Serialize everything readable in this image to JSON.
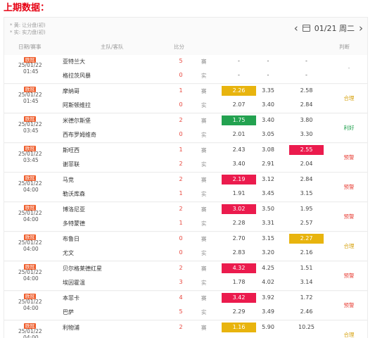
{
  "title": "上期数据：",
  "notes": [
    "* 黄: 让分盘(初)",
    "* 实: 实力盘(初)"
  ],
  "nav": {
    "prev": "‹",
    "next": "›",
    "date": "01/21 周二"
  },
  "columns": {
    "date": "日期/赛事",
    "teams": "主队/客队",
    "score": "比分",
    "judge": "判断"
  },
  "colors": {
    "yellow": "#e8b40e",
    "green": "#23a250",
    "red": "#eb1b4d",
    "win": "#23a250",
    "verdict_red": "#e8453c",
    "verdict_yellow": "#d6a10d"
  },
  "matches": [
    {
      "league": "欧冠",
      "date": "25/01/22",
      "time": "01:45",
      "home": "亚特兰大",
      "away": "格拉茨风暴",
      "hs": "5",
      "as": "0",
      "tag1": "赛",
      "tag2": "实",
      "r1": [
        "-",
        "-",
        "-"
      ],
      "r2": [
        "-",
        "-",
        "-"
      ],
      "hl": [
        null,
        null,
        null
      ],
      "verdict": "-",
      "vcolor": "#999"
    },
    {
      "league": "欧冠",
      "date": "25/01/22",
      "time": "01:45",
      "home": "摩纳哥",
      "away": "阿斯顿维拉",
      "hs": "1",
      "as": "0",
      "tag1": "赛",
      "tag2": "实",
      "r1": [
        "2.26",
        "3.35",
        "2.58"
      ],
      "r2": [
        "2.07",
        "3.40",
        "2.84"
      ],
      "hl": [
        "yellow",
        null,
        null
      ],
      "verdict": "合理",
      "vcolor": "#d6a10d"
    },
    {
      "league": "欧冠",
      "date": "25/01/22",
      "time": "03:45",
      "home": "米德尔斯堡",
      "away": "西布罗姆维奇",
      "hs": "2",
      "as": "0",
      "tag1": "赛",
      "tag2": "实",
      "r1": [
        "1.75",
        "3.40",
        "3.80"
      ],
      "r2": [
        "2.01",
        "3.05",
        "3.30"
      ],
      "hl": [
        "green",
        null,
        null
      ],
      "verdict": "利好",
      "vcolor": "#23a250"
    },
    {
      "league": "欧冠",
      "date": "25/01/22",
      "time": "03:45",
      "home": "斯旺西",
      "away": "谢菲联",
      "hs": "1",
      "as": "2",
      "tag1": "赛",
      "tag2": "实",
      "r1": [
        "2.43",
        "3.08",
        "2.55"
      ],
      "r2": [
        "3.40",
        "2.91",
        "2.04"
      ],
      "hl": [
        null,
        null,
        "red"
      ],
      "verdict": "预警",
      "vcolor": "#e8453c"
    },
    {
      "league": "欧冠",
      "date": "25/01/22",
      "time": "04:00",
      "home": "马竞",
      "away": "勒沃库森",
      "hs": "2",
      "as": "1",
      "tag1": "赛",
      "tag2": "实",
      "r1": [
        "2.19",
        "3.12",
        "2.84"
      ],
      "r2": [
        "1.91",
        "3.45",
        "3.15"
      ],
      "hl": [
        "red",
        null,
        null
      ],
      "verdict": "预警",
      "vcolor": "#e8453c"
    },
    {
      "league": "欧冠",
      "date": "25/01/22",
      "time": "04:00",
      "home": "博洛尼亚",
      "away": "多特蒙德",
      "hs": "2",
      "as": "1",
      "tag1": "赛",
      "tag2": "实",
      "r1": [
        "3.02",
        "3.50",
        "1.95"
      ],
      "r2": [
        "2.28",
        "3.31",
        "2.57"
      ],
      "hl": [
        "red",
        null,
        null
      ],
      "verdict": "预警",
      "vcolor": "#e8453c"
    },
    {
      "league": "欧冠",
      "date": "25/01/22",
      "time": "04:00",
      "home": "布鲁日",
      "away": "尤文",
      "hs": "0",
      "as": "0",
      "tag1": "赛",
      "tag2": "实",
      "r1": [
        "2.70",
        "3.15",
        "2.27"
      ],
      "r2": [
        "2.83",
        "3.20",
        "2.16"
      ],
      "hl": [
        null,
        null,
        "yellow"
      ],
      "verdict": "合理",
      "vcolor": "#d6a10d"
    },
    {
      "league": "欧冠",
      "date": "25/01/22",
      "time": "04:00",
      "home": "贝尔格莱德红星",
      "away": "埃因霍温",
      "hs": "2",
      "as": "3",
      "tag1": "赛",
      "tag2": "实",
      "r1": [
        "4.32",
        "4.25",
        "1.51"
      ],
      "r2": [
        "1.78",
        "4.02",
        "3.14"
      ],
      "hl": [
        "red",
        null,
        null
      ],
      "verdict": "预警",
      "vcolor": "#e8453c"
    },
    {
      "league": "欧冠",
      "date": "25/01/22",
      "time": "04:00",
      "home": "本菲卡",
      "away": "巴萨",
      "hs": "4",
      "as": "5",
      "tag1": "赛",
      "tag2": "实",
      "r1": [
        "3.42",
        "3.92",
        "1.72"
      ],
      "r2": [
        "2.29",
        "3.49",
        "2.46"
      ],
      "hl": [
        "red",
        null,
        null
      ],
      "verdict": "预警",
      "vcolor": "#e8453c"
    },
    {
      "league": "欧冠",
      "date": "25/01/22",
      "time": "04:00",
      "home": "利物浦",
      "away": "里尔",
      "hs": "2",
      "as": "1",
      "tag1": "赛",
      "tag2": "实",
      "r1": [
        "1.16",
        "5.90",
        "10.25"
      ],
      "r2": [
        "1.15",
        "6.01",
        "10.85"
      ],
      "hl": [
        "yellow",
        null,
        null
      ],
      "verdict": "合理",
      "vcolor": "#d6a10d"
    }
  ]
}
